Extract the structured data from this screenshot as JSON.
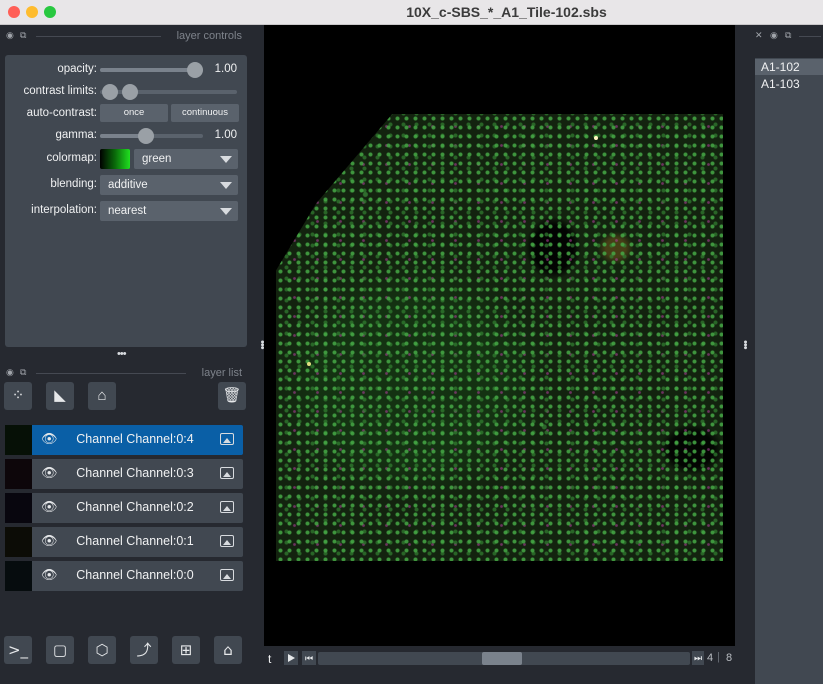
{
  "window": {
    "title": "10X_c-SBS_*_A1_Tile-102.sbs"
  },
  "layer_controls": {
    "header": "layer controls",
    "opacity": {
      "label": "opacity:",
      "value": "1.00",
      "fraction": 1.0
    },
    "contrast_limits": {
      "label": "contrast limits:"
    },
    "auto_contrast": {
      "label": "auto-contrast:",
      "once": "once",
      "continuous": "continuous"
    },
    "gamma": {
      "label": "gamma:",
      "value": "1.00"
    },
    "colormap": {
      "label": "colormap:",
      "value": "green"
    },
    "blending": {
      "label": "blending:",
      "value": "additive"
    },
    "interpolation": {
      "label": "interpolation:",
      "value": "nearest"
    }
  },
  "layer_list": {
    "header": "layer list",
    "layers": [
      {
        "name": "Channel Channel:0:4",
        "selected": true
      },
      {
        "name": "Channel Channel:0:3",
        "selected": false
      },
      {
        "name": "Channel Channel:0:2",
        "selected": false
      },
      {
        "name": "Channel Channel:0:1",
        "selected": false
      },
      {
        "name": "Channel Channel:0:0",
        "selected": false
      }
    ]
  },
  "dims": {
    "axis_label": "t",
    "current": "4",
    "total": "8"
  },
  "tiles": {
    "items": [
      "A1-102",
      "A1-103"
    ],
    "selected": "A1-102"
  },
  "colors": {
    "selected_layer": "#0a5fa6",
    "panel": "#414851",
    "background": "#262930"
  }
}
